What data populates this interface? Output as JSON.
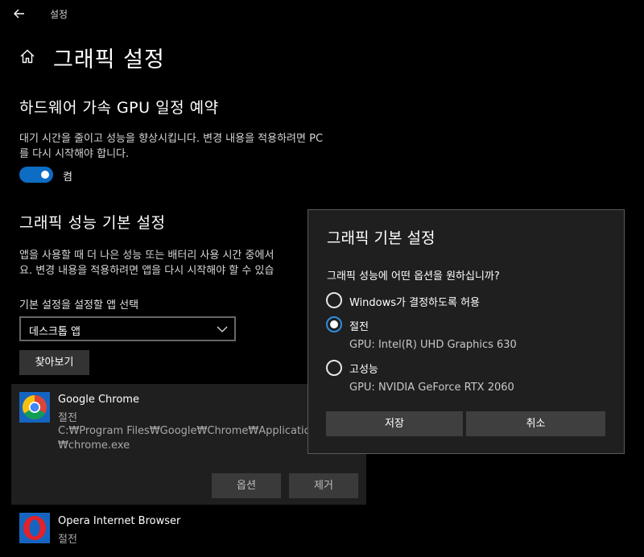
{
  "window": {
    "title": "설정"
  },
  "page": {
    "title": "그래픽 설정"
  },
  "gpu_scheduling": {
    "title": "하드웨어 가속 GPU 일정 예약",
    "description_line1": "대기 시간을 줄이고 성능을 향상시킵니다. 변경 내용을 적용하려면 PC",
    "description_line2": "를 다시 시작해야 합니다.",
    "toggle_state": "켬",
    "toggle_on": true
  },
  "graphics_pref": {
    "title": "그래픽 성능 기본 설정",
    "description_line1": "앱을 사용할 때 더 나은 성능 또는 배터리 사용 시간 중에서",
    "description_line2": "요. 변경 내용을 적용하려면 앱을 다시 시작해야 할 수 있습",
    "select_label": "기본 설정을 설정할 앱 선택",
    "select_value": "데스크톱 앱",
    "browse_label": "찾아보기"
  },
  "apps": [
    {
      "name": "Google Chrome",
      "pref": "절전",
      "path_line1": "C:₩Program Files₩Google₩Chrome₩Application",
      "path_line2": "₩chrome.exe",
      "icon": "chrome-icon"
    },
    {
      "name": "Opera Internet Browser",
      "pref": "절전",
      "icon": "opera-icon"
    }
  ],
  "card_buttons": {
    "options": "옵션",
    "remove": "제거"
  },
  "dialog": {
    "title": "그래픽 기본 설정",
    "question": "그래픽 성능에 어떤 옵션을 원하십니까?",
    "options": [
      {
        "label": "Windows가 결정하도록 허용",
        "sub": "",
        "selected": false
      },
      {
        "label": "절전",
        "sub": "GPU: Intel(R) UHD Graphics 630",
        "selected": true
      },
      {
        "label": "고성능",
        "sub": "GPU: NVIDIA GeForce RTX 2060",
        "selected": false
      }
    ],
    "save": "저장",
    "cancel": "취소"
  },
  "colors": {
    "accent": "#0d6cc4",
    "radio_selected": "#2e8de0",
    "background": "#000000",
    "dialog_bg": "#1f1f1f"
  }
}
